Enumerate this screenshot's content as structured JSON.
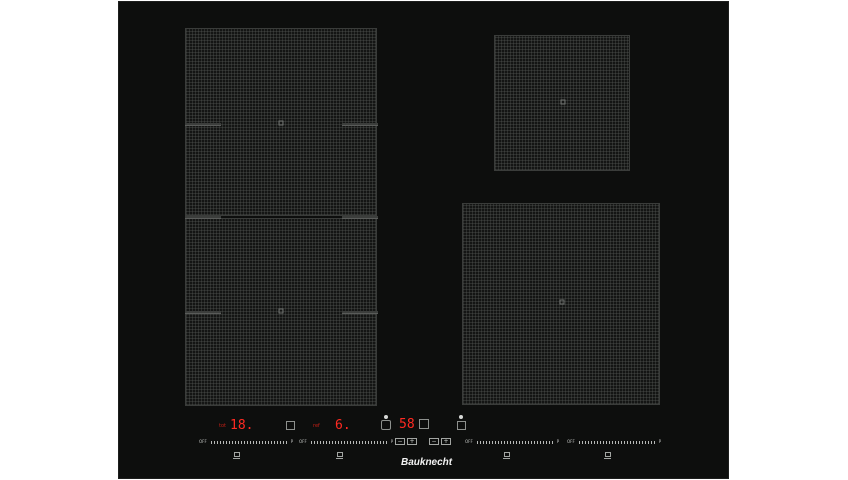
{
  "displays": {
    "zone_left_level": "18.",
    "zone_left_bottom_level": "6.",
    "timer": "58"
  },
  "labels": {
    "left_prefix": "tot",
    "right_prefix": "ref",
    "off_label": "OFF",
    "p_label": "P"
  },
  "brand": {
    "name": "Bauknecht"
  },
  "colors": {
    "glass": "#0d0e0d",
    "display_red": "#ff2a22"
  }
}
